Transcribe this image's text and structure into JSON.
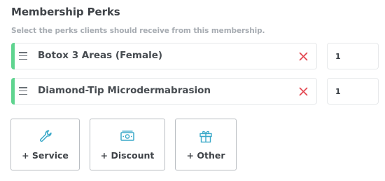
{
  "section": {
    "title": "Membership Perks",
    "subtitle": "Select the perks clients should receive from this membership."
  },
  "perks": [
    {
      "name": "Botox 3 Areas (Female)",
      "quantity": "1"
    },
    {
      "name": "Diamond-Tip Microdermabrasion",
      "quantity": "1"
    }
  ],
  "add_buttons": [
    {
      "label": "+ Service",
      "icon": "wrench-icon"
    },
    {
      "label": "+ Discount",
      "icon": "money-icon"
    },
    {
      "label": "+ Other",
      "icon": "gift-icon"
    }
  ],
  "colors": {
    "accent_green": "#5fd48f",
    "remove_red": "#e2404a",
    "icon_teal": "#3aa9c9"
  }
}
